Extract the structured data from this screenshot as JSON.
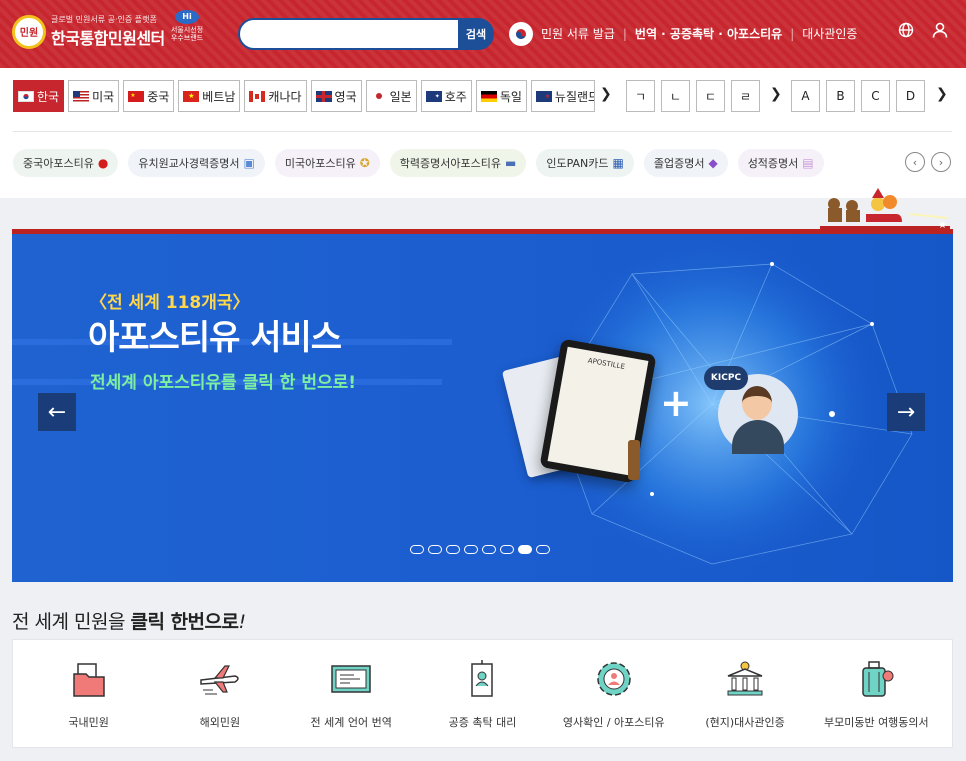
{
  "header": {
    "logo_small": "글로벌 민원서류 공·인증 플랫폼",
    "logo_badge": "민원",
    "logo_title": "한국통합민원센터",
    "hiseoul_mark": "Hi",
    "hiseoul": "서울시선정 우수브랜드",
    "search_placeholder": "",
    "search_button": "검색",
    "nav": [
      "민원 서류 발급",
      "번역 · 공증촉탁 · 아포스티유",
      "대사관인증"
    ],
    "icons": [
      "globe-icon",
      "user-icon"
    ]
  },
  "countries": {
    "items": [
      {
        "label": "한국",
        "active": true
      },
      {
        "label": "미국",
        "active": false
      },
      {
        "label": "중국",
        "active": false
      },
      {
        "label": "베트남",
        "active": false
      },
      {
        "label": "캐나다",
        "active": false
      },
      {
        "label": "영국",
        "active": false
      },
      {
        "label": "일본",
        "active": false
      },
      {
        "label": "호주",
        "active": false
      },
      {
        "label": "독일",
        "active": false
      },
      {
        "label": "뉴질랜드",
        "active": false
      }
    ],
    "next": "❯",
    "hangul": [
      "ㄱ",
      "ㄴ",
      "ㄷ",
      "ㄹ"
    ],
    "hangul_next": "❯",
    "alpha": [
      "A",
      "B",
      "C",
      "D"
    ],
    "alpha_next": "❯"
  },
  "chips": [
    {
      "label": "중국아포스티유",
      "bg": "#eef5f1"
    },
    {
      "label": "유치원교사경력증명서",
      "bg": "#f0f3f8"
    },
    {
      "label": "미국아포스티유",
      "bg": "#f6f0f8"
    },
    {
      "label": "학력증명서아포스티유",
      "bg": "#eff5e8"
    },
    {
      "label": "인도PAN카드",
      "bg": "#eef4f1"
    },
    {
      "label": "졸업증명서",
      "bg": "#f0f3f8"
    },
    {
      "label": "성적증명서",
      "bg": "#f6f0f8"
    }
  ],
  "chip_nav": {
    "prev": "‹",
    "next": "›"
  },
  "banner": {
    "subtitle": "〈전 세계 118개국〉",
    "title": "아포스티유 서비스",
    "description": "전세계 아포스티유를 클릭 한 번으로!",
    "prev": "←",
    "next": "→",
    "slide_count": 8,
    "active_slide": 7,
    "doc_label": "APOSTILLE",
    "badge": "KICPC"
  },
  "section": {
    "title_plain": "전 세계 민원을 ",
    "title_bold": "클릭 한번으로",
    "title_end": "!"
  },
  "services": [
    {
      "label": "국내민원",
      "icon": "folder-icon"
    },
    {
      "label": "해외민원",
      "icon": "airplane-icon"
    },
    {
      "label": "전 세계 언어 번역",
      "icon": "translation-icon"
    },
    {
      "label": "공증 촉탁 대리",
      "icon": "id-badge-icon"
    },
    {
      "label": "영사확인 / 아포스티유",
      "icon": "gear-person-icon"
    },
    {
      "label": "(현지)대사관인증",
      "icon": "embassy-icon"
    },
    {
      "label": "부모미동반 여행동의서",
      "icon": "luggage-icon"
    }
  ],
  "colors": {
    "brand_red": "#c8262f",
    "navy": "#1d4f99",
    "banner_blue": "#1c5ed0"
  }
}
